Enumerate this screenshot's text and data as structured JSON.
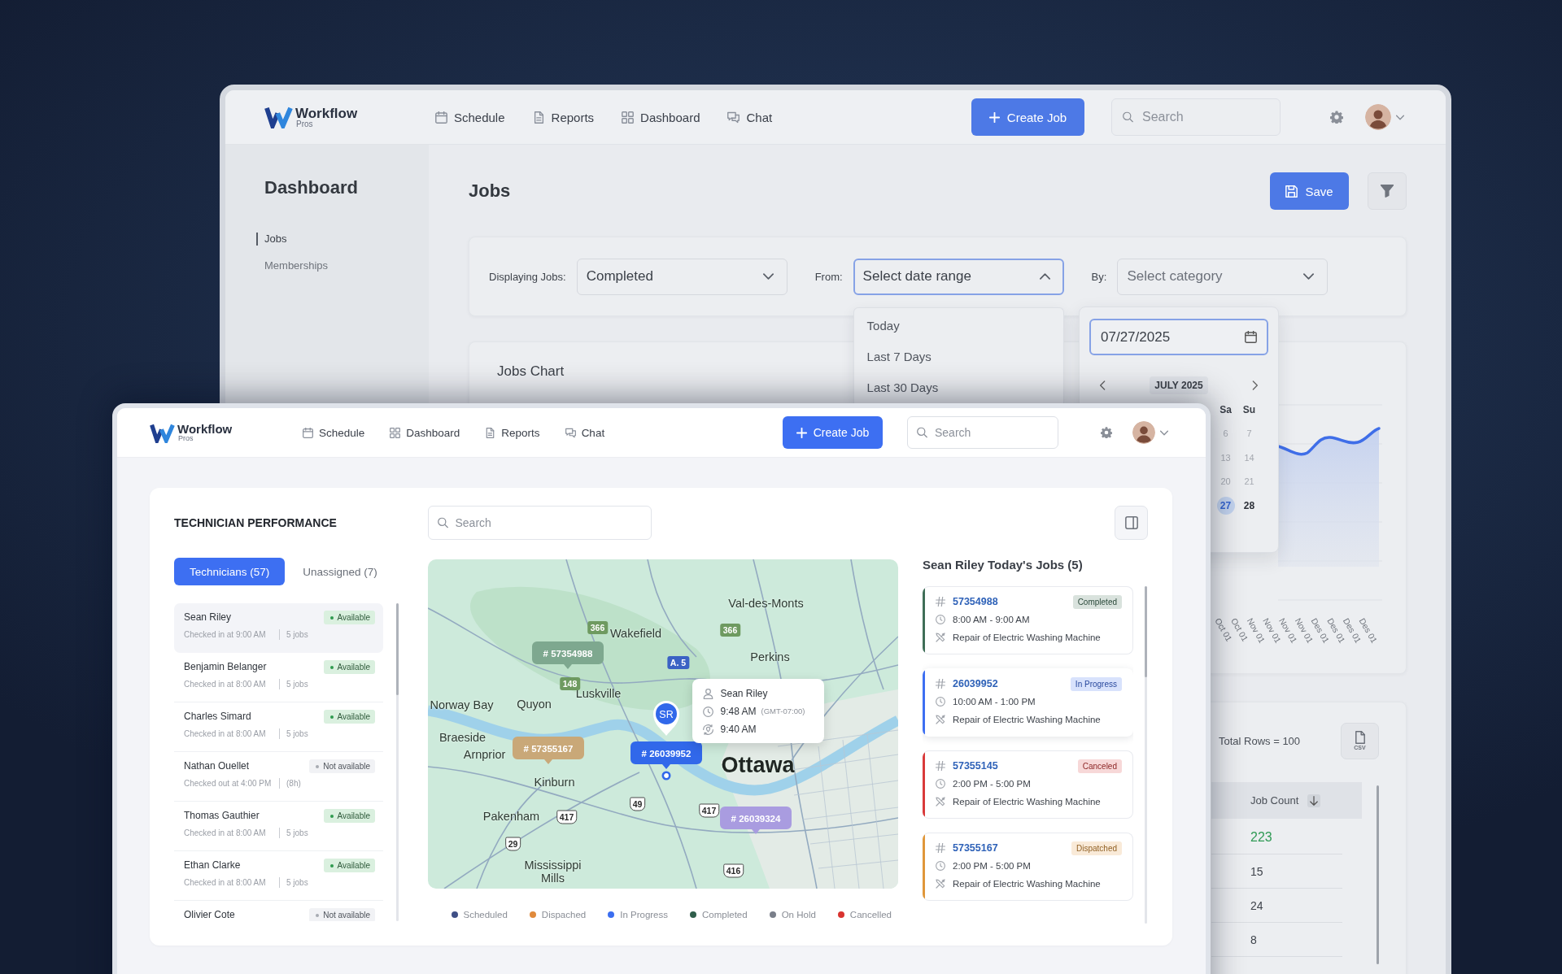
{
  "back_window": {
    "header": {
      "logo": {
        "name": "Workflow",
        "tagline": "Pros"
      },
      "nav": [
        {
          "label": "Schedule",
          "kind": "calendar"
        },
        {
          "label": "Reports",
          "kind": "document"
        },
        {
          "label": "Dashboard",
          "kind": "grid"
        },
        {
          "label": "Chat",
          "kind": "chat"
        }
      ],
      "create_button": "Create Job",
      "search": {
        "placeholder": "Search"
      }
    },
    "sidebar": {
      "title": "Dashboard",
      "items": [
        {
          "label": "Jobs",
          "selected": true
        },
        {
          "label": "Memberships",
          "selected": false
        }
      ]
    },
    "page_title": "Jobs",
    "save_button": "Save",
    "filters": [
      {
        "label": "Displaying Jobs:",
        "value": "Completed",
        "expanded": false
      },
      {
        "label": "From:",
        "placeholder": "Select date range",
        "expanded": true,
        "options": [
          "Today",
          "Last 7 Days",
          "Last 30 Days"
        ]
      },
      {
        "label": "By:",
        "placeholder": "Select category",
        "expanded": false
      }
    ],
    "date_picker": {
      "value": "07/27/2025",
      "month": "JULY 2025",
      "weekdays": [
        "Sa",
        "Su"
      ],
      "weeks": [
        [
          {
            "label": "6",
            "selected": false,
            "disabled": true
          },
          {
            "label": "7",
            "selected": false,
            "disabled": true
          }
        ],
        [
          {
            "label": "13",
            "selected": false,
            "disabled": true
          },
          {
            "label": "14",
            "selected": false,
            "disabled": true
          }
        ],
        [
          {
            "label": "20",
            "selected": false,
            "disabled": true
          },
          {
            "label": "21",
            "selected": false,
            "disabled": true
          }
        ],
        [
          {
            "label": "27",
            "selected": true,
            "disabled": false
          },
          {
            "label": "28",
            "selected": false,
            "disabled": false
          }
        ]
      ]
    },
    "jobs_chart": {
      "title": "Jobs Chart",
      "x_labels": [
        "Oct 01",
        "Oct 01",
        "Nov 01",
        "Nov 01",
        "Nov 01",
        "Nov 01",
        "Des 01",
        "Des 01",
        "Des 01",
        "Des 01"
      ]
    },
    "jobs_table": {
      "total": "Total Rows = 100",
      "export_label": "CSV",
      "columns": [
        {
          "label": "Job Count",
          "sorted": true
        }
      ],
      "rows": [
        {
          "value": "223",
          "highlight": true
        },
        {
          "value": "15",
          "highlight": false
        },
        {
          "value": "24",
          "highlight": false
        },
        {
          "value": "8",
          "highlight": false
        }
      ]
    }
  },
  "front_window": {
    "header": {
      "logo": {
        "name": "Workflow",
        "tagline": "Pros"
      },
      "nav": [
        {
          "label": "Schedule",
          "kind": "calendar"
        },
        {
          "label": "Dashboard",
          "kind": "grid"
        },
        {
          "label": "Reports",
          "kind": "document"
        },
        {
          "label": "Chat",
          "kind": "chat"
        }
      ],
      "create_button": "Create Job",
      "search": {
        "placeholder": "Search"
      }
    },
    "panel": {
      "title": "TECHNICIAN PERFORMANCE",
      "search": {
        "placeholder": "Search"
      },
      "tabs": [
        {
          "label": "Technicians (57)",
          "selected": true
        },
        {
          "label": "Unassigned (7)",
          "selected": false
        }
      ],
      "technicians": [
        {
          "name": "Sean Riley",
          "status": "Available",
          "available": true,
          "detail": "Checked in at 9:00 AM",
          "jobs": "5 jobs",
          "selected": true
        },
        {
          "name": "Benjamin Belanger",
          "status": "Available",
          "available": true,
          "detail": "Checked in at 8:00 AM",
          "jobs": "5 jobs",
          "selected": false
        },
        {
          "name": "Charles Simard",
          "status": "Available",
          "available": true,
          "detail": "Checked in at 8:00 AM",
          "jobs": "5 jobs",
          "selected": false
        },
        {
          "name": "Nathan Ouellet",
          "status": "Not available",
          "available": false,
          "detail": "Checked out at 4:00 PM",
          "jobs": "(8h)",
          "selected": false
        },
        {
          "name": "Thomas Gauthier",
          "status": "Available",
          "available": true,
          "detail": "Checked in at 8:00 AM",
          "jobs": "5 jobs",
          "selected": false
        },
        {
          "name": "Ethan Clarke",
          "status": "Available",
          "available": true,
          "detail": "Checked in at 8:00 AM",
          "jobs": "5 jobs",
          "selected": false
        },
        {
          "name": "Olivier Cote",
          "status": "Not available",
          "available": false,
          "selected": false
        }
      ],
      "map": {
        "places": [
          {
            "label": "Val-des-Monts",
            "kind": "town"
          },
          {
            "label": "Wakefield",
            "kind": "town"
          },
          {
            "label": "Perkins",
            "kind": "town"
          },
          {
            "label": "Luskville",
            "kind": "town"
          },
          {
            "label": "Norway Bay",
            "kind": "town"
          },
          {
            "label": "Quyon",
            "kind": "town"
          },
          {
            "label": "Braeside",
            "kind": "town"
          },
          {
            "label": "Arnprior",
            "kind": "town"
          },
          {
            "label": "Kinburn",
            "kind": "town"
          },
          {
            "label": "Ottawa",
            "kind": "city"
          },
          {
            "label": "Pakenham",
            "kind": "town"
          },
          {
            "label": "Mississippi Mills",
            "kind": "town"
          }
        ],
        "roads": [
          {
            "label": "366",
            "kind": "route"
          },
          {
            "label": "366",
            "kind": "route"
          },
          {
            "label": "148",
            "kind": "route"
          },
          {
            "label": "A. 5",
            "kind": "autoroute"
          },
          {
            "label": "49",
            "kind": "highway"
          },
          {
            "label": "417",
            "kind": "highway"
          },
          {
            "label": "417",
            "kind": "highway"
          },
          {
            "label": "29",
            "kind": "highway"
          },
          {
            "label": "416",
            "kind": "highway"
          }
        ],
        "pins": [
          {
            "label": "# 57354988",
            "color": "#7ea88f"
          },
          {
            "label": "# 57355167",
            "color": "#c9a878"
          },
          {
            "label": "# 26039952",
            "color": "#3168ea"
          },
          {
            "label": "# 26039324",
            "color": "#a99ce0"
          }
        ],
        "marker": {
          "initials": "SR"
        },
        "tooltip": {
          "name": "Sean Riley",
          "time": "9:48 AM",
          "zone": "(GMT-07:00)",
          "check_in": "9:40 AM"
        }
      },
      "legend": [
        {
          "label": "Scheduled",
          "color": "#3f4f86"
        },
        {
          "label": "Dispached",
          "color": "#e08a3c"
        },
        {
          "label": "In Progress",
          "color": "#3b6ef0"
        },
        {
          "label": "Completed",
          "color": "#2f5e4b"
        },
        {
          "label": "On Hold",
          "color": "#7a7f8a"
        },
        {
          "label": "Cancelled",
          "color": "#d9332f"
        }
      ],
      "jobs_title": "Sean Riley Today's Jobs (5)",
      "jobs": [
        {
          "id": "57354988",
          "status": "Completed",
          "color": "#3f6e57",
          "time": "8:00 AM - 9:00 AM",
          "task": "Repair of Electric Washing Machine",
          "selected": false
        },
        {
          "id": "26039952",
          "status": "In Progress",
          "color": "#3d6ff2",
          "time": "10:00 AM - 1:00 PM",
          "task": "Repair of Electric Washing Machine",
          "selected": true
        },
        {
          "id": "57355145",
          "status": "Canceled",
          "color": "#d93a3a",
          "time": "2:00 PM - 5:00 PM",
          "task": "Repair of Electric Washing Machine",
          "selected": false
        },
        {
          "id": "57355167",
          "status": "Dispatched",
          "color": "#e0973a",
          "time": "2:00 PM - 5:00 PM",
          "task": "Repair of Electric Washing Machine",
          "selected": false
        }
      ]
    }
  }
}
